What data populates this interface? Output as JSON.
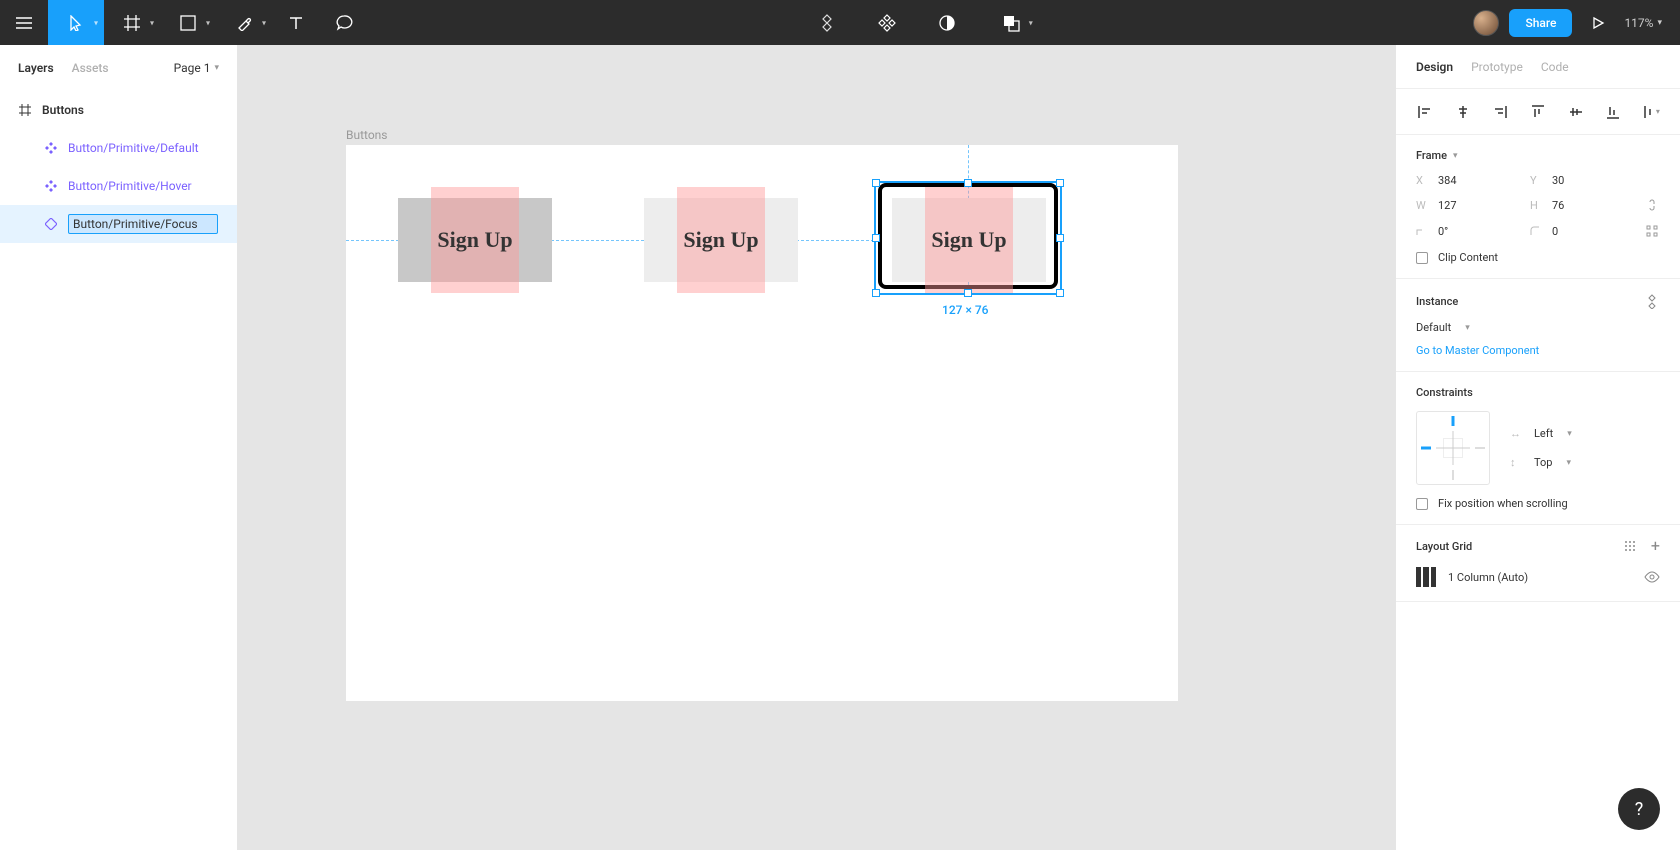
{
  "toolbar": {
    "share_label": "Share",
    "zoom": "117%"
  },
  "left_panel": {
    "tabs": {
      "layers": "Layers",
      "assets": "Assets"
    },
    "page": "Page 1"
  },
  "layers": {
    "frame": "Buttons",
    "items": [
      "Button/Primitive/Default",
      "Button/Primitive/Hover",
      "Button/Primitive/Focus"
    ]
  },
  "canvas": {
    "frame_label": "Buttons",
    "button_text": "Sign Up",
    "selection_dims": "127 × 76"
  },
  "right_panel": {
    "tabs": {
      "design": "Design",
      "prototype": "Prototype",
      "code": "Code"
    },
    "frame_section": {
      "title": "Frame",
      "x": "384",
      "y": "30",
      "w": "127",
      "h": "76",
      "rotation": "0°",
      "radius": "0",
      "clip": "Clip Content"
    },
    "instance": {
      "title": "Instance",
      "variant": "Default",
      "master_link": "Go to Master Component"
    },
    "constraints": {
      "title": "Constraints",
      "horizontal": "Left",
      "vertical": "Top",
      "fix": "Fix position when scrolling"
    },
    "layout_grid": {
      "title": "Layout Grid",
      "value": "1 Column (Auto)"
    }
  }
}
